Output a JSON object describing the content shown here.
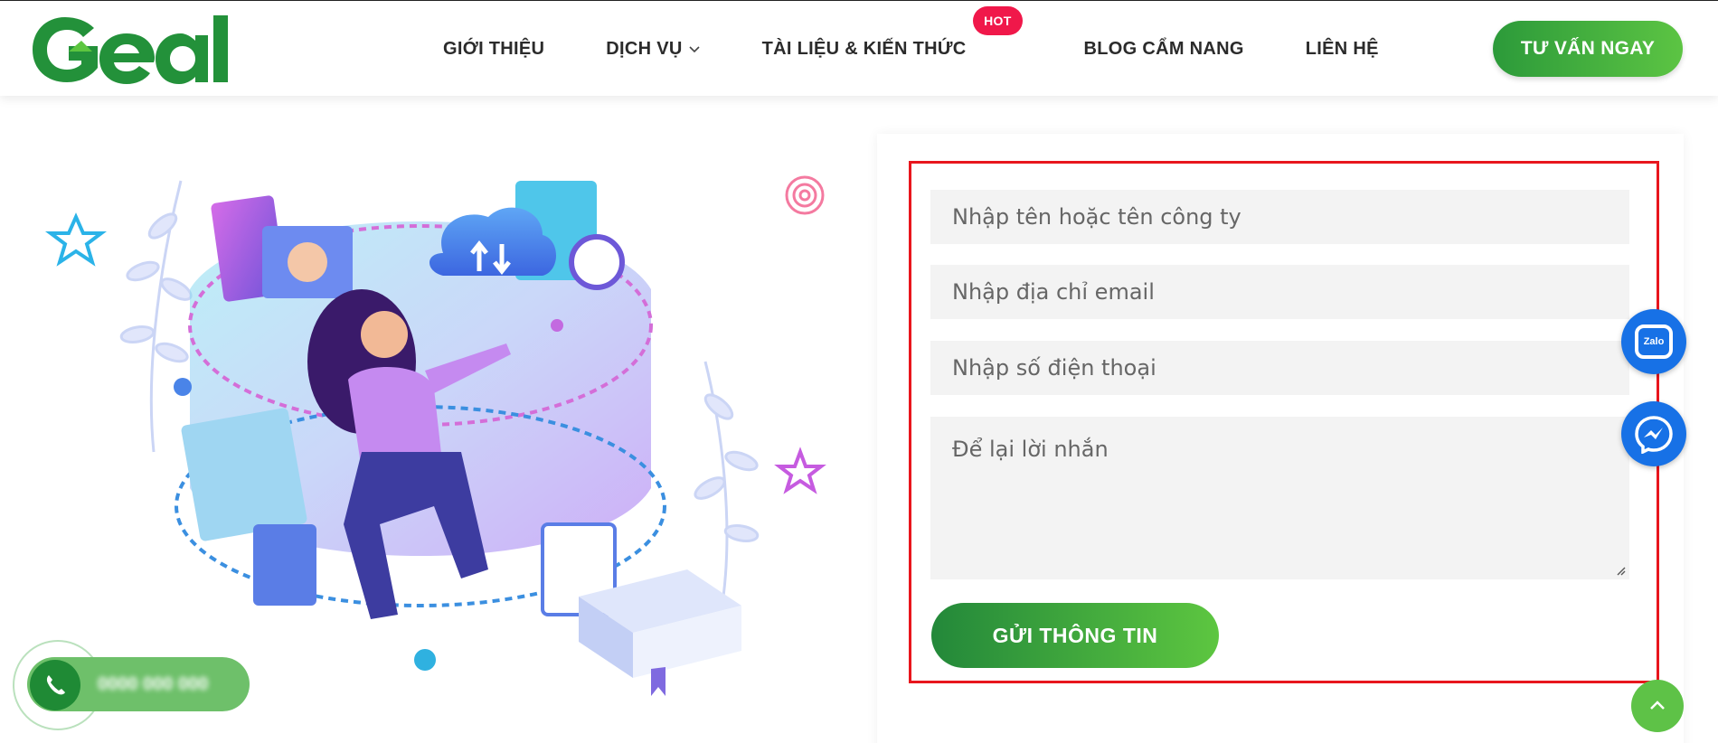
{
  "header": {
    "logo_text": "Geal",
    "nav": [
      {
        "label": "GIỚI THIỆU"
      },
      {
        "label": "DỊCH VỤ"
      },
      {
        "label": "TÀI LIỆU & KIẾN THỨC",
        "badge": "HOT"
      },
      {
        "label": "BLOG CẨM NANG"
      },
      {
        "label": "LIÊN HỆ"
      }
    ],
    "cta_label": "TƯ VẤN NGAY"
  },
  "form": {
    "name_placeholder": "Nhập tên hoặc tên công ty",
    "email_placeholder": "Nhập địa chỉ email",
    "phone_placeholder": "Nhập số điện thoại",
    "message_placeholder": "Để lại lời nhắn",
    "submit_label": "GỬI THÔNG TIN"
  },
  "widgets": {
    "zalo_label": "Zalo",
    "phone_number": "0000 000 000"
  },
  "colors": {
    "brand_green": "#2c9a3a",
    "accent_green": "#5cc443",
    "hot_badge": "#f0184a",
    "highlight_border": "#e8161d",
    "widget_blue": "#1771e6"
  },
  "icons": [
    "chevron-down-icon",
    "zalo-icon",
    "messenger-icon",
    "arrow-up-icon",
    "phone-icon"
  ]
}
